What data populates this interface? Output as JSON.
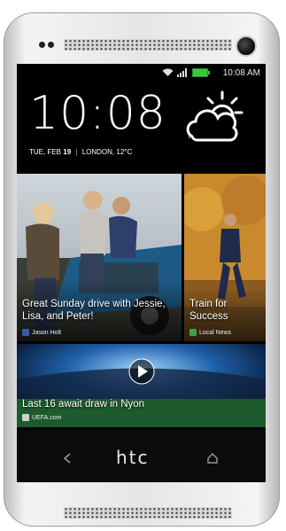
{
  "status": {
    "time": "10:08 AM"
  },
  "clock": {
    "time": "10:08",
    "ampm": "AM"
  },
  "date": {
    "day": "TUE, FEB",
    "daynum": "19",
    "sep": "|",
    "location": "LONDON,",
    "temp": "12°C"
  },
  "tiles": [
    {
      "caption": "Great Sunday drive with Jessie, Lisa, and Peter!",
      "source": "Jason Holt"
    },
    {
      "caption": "Train for Success",
      "source": "Local News"
    },
    {
      "caption": "Last 16 await draw in Nyon",
      "source": "UEFA.com"
    }
  ],
  "device": {
    "brand": "htc"
  },
  "colors": {
    "battery": "#3ec43e",
    "facebook": "#3b5998",
    "news": "#43a047",
    "accent": "#ffffff"
  },
  "icons": [
    "phone-icon",
    "messages-icon",
    "apps-grid-icon",
    "browser-globe-icon",
    "camera-icon",
    "back-icon",
    "home-icon"
  ]
}
